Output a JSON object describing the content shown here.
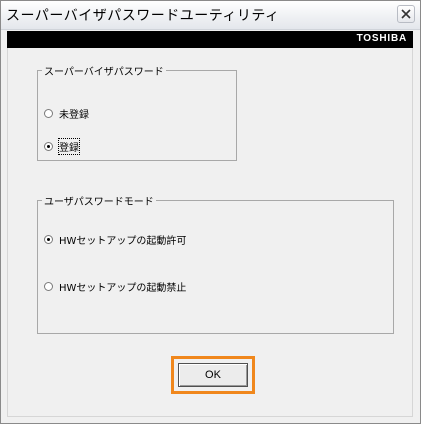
{
  "window": {
    "title": "スーパーバイザパスワードユーティリティ",
    "brand": "TOSHIBA"
  },
  "supervisor_group": {
    "legend": "スーパーバイザパスワード",
    "options": [
      {
        "label": "未登録",
        "checked": false
      },
      {
        "label": "登録",
        "checked": true
      }
    ]
  },
  "user_mode_group": {
    "legend": "ユーザパスワードモード",
    "options": [
      {
        "label": "HWセットアップの起動許可",
        "checked": true
      },
      {
        "label": "HWセットアップの起動禁止",
        "checked": false
      }
    ]
  },
  "actions": {
    "ok_label": "OK",
    "highlight_color": "#f0871c"
  }
}
